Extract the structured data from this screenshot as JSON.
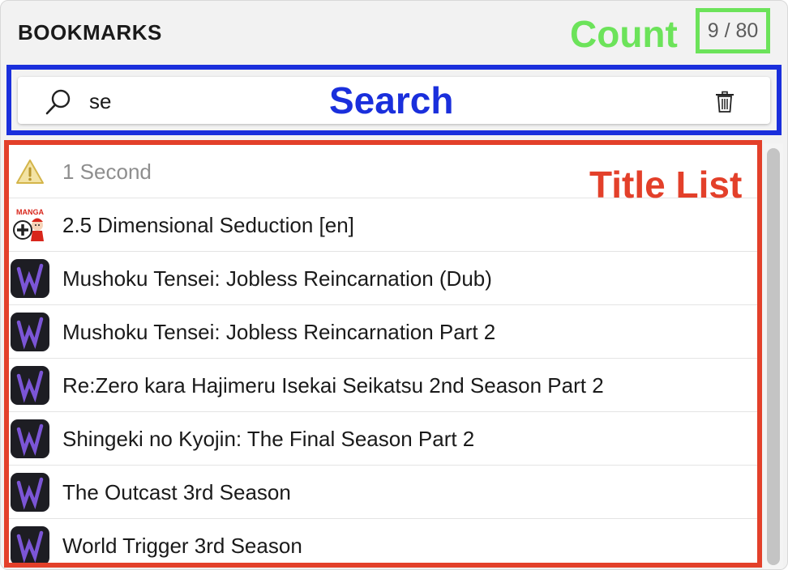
{
  "header": {
    "title": "BOOKMARKS",
    "count": "9 / 80"
  },
  "annotations": {
    "count": {
      "label": "Count",
      "color": "#6ce35a"
    },
    "search": {
      "label": "Search",
      "color": "#1a2fdc"
    },
    "title_list": {
      "label": "Title List",
      "color": "#e3402a"
    }
  },
  "search": {
    "value": "se",
    "search_icon": "search-icon",
    "clear_icon": "trash-icon"
  },
  "list": {
    "items": [
      {
        "title": "1 Second",
        "icon": "warning-icon",
        "muted": true
      },
      {
        "title": "2.5 Dimensional Seduction [en]",
        "icon": "manga-plus-icon"
      },
      {
        "title": "Mushoku Tensei: Jobless Reincarnation (Dub)",
        "icon": "w-logo-icon"
      },
      {
        "title": "Mushoku Tensei: Jobless Reincarnation Part 2",
        "icon": "w-logo-icon"
      },
      {
        "title": "Re:Zero kara Hajimeru Isekai Seikatsu 2nd Season Part 2",
        "icon": "w-logo-icon"
      },
      {
        "title": "Shingeki no Kyojin: The Final Season Part 2",
        "icon": "w-logo-icon"
      },
      {
        "title": "The Outcast 3rd Season",
        "icon": "w-logo-icon"
      },
      {
        "title": "World Trigger 3rd Season",
        "icon": "w-logo-icon"
      }
    ]
  },
  "colors": {
    "warning": "#e8c85a",
    "w_logo_bg": "#1d1d23",
    "w_logo_fg": "#7b55d6"
  }
}
